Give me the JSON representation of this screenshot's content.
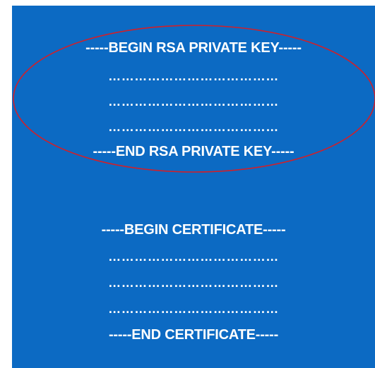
{
  "key_block": {
    "begin": "-----BEGIN RSA PRIVATE KEY-----",
    "lines": [
      "…………………………………",
      "…………………………………",
      "…………………………………"
    ],
    "end": "-----END RSA PRIVATE KEY-----"
  },
  "cert_block": {
    "begin": "-----BEGIN CERTIFICATE-----",
    "lines": [
      "…………………………………",
      "…………………………………",
      "…………………………………"
    ],
    "end": "-----END CERTIFICATE-----"
  },
  "colors": {
    "background": "#0c6ac3",
    "text": "#ffffff",
    "highlight": "#d0202a"
  }
}
